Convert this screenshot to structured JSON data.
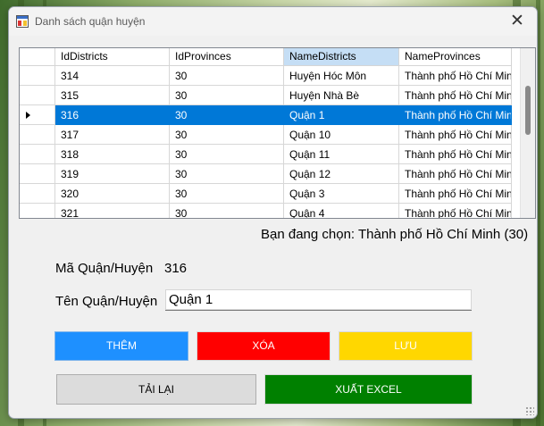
{
  "window": {
    "title": "Danh sách quận huyện"
  },
  "grid": {
    "columns": [
      "IdDistricts",
      "IdProvinces",
      "NameDistricts",
      "NameProvinces"
    ],
    "rows": [
      [
        "314",
        "30",
        "Huyện Hóc Môn",
        "Thành phố Hồ Chí Minh"
      ],
      [
        "315",
        "30",
        "Huyện Nhà Bè",
        "Thành phố Hồ Chí Minh"
      ],
      [
        "316",
        "30",
        "Quận 1",
        "Thành phố Hồ Chí Minh"
      ],
      [
        "317",
        "30",
        "Quận 10",
        "Thành phố Hồ Chí Minh"
      ],
      [
        "318",
        "30",
        "Quận 11",
        "Thành phố Hồ Chí Minh"
      ],
      [
        "319",
        "30",
        "Quận 12",
        "Thành phố Hồ Chí Minh"
      ],
      [
        "320",
        "30",
        "Quận 3",
        "Thành phố Hồ Chí Minh"
      ],
      [
        "321",
        "30",
        "Quận 4",
        "Thành phố Hồ Chí Minh"
      ]
    ],
    "selected_row_index": 2
  },
  "selection_info": "Bạn đang chọn: Thành phố Hồ Chí Minh (30)",
  "form": {
    "ma_label": "Mã Quận/Huyện",
    "ma_value": "316",
    "ten_label": "Tên Quận/Huyện",
    "ten_value": "Quận 1"
  },
  "buttons": {
    "them": "THÊM",
    "xoa": "XÓA",
    "luu": "LƯU",
    "tai_lai": "TẢI LẠI",
    "xuat_excel": "XUẤT EXCEL"
  },
  "colors": {
    "them_bg": "#1e90ff",
    "xoa_bg": "#ff0000",
    "luu_bg": "#ffd700",
    "luu_text": "#ffffff",
    "tai_lai_bg": "#dcdcdc",
    "xuat_excel_bg": "#008000",
    "selected_row": "#0078d7",
    "selected_header": "#c5def5"
  },
  "icons": {
    "app": "app-window-icon",
    "close": "close-icon",
    "row_pointer": "row-pointer-icon"
  }
}
